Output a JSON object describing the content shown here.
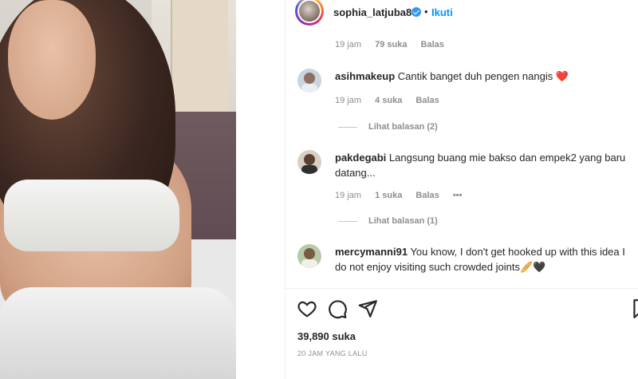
{
  "post": {
    "owner": "sophia_latjuba88",
    "verified": true,
    "separator": "•",
    "follow_label": "Ikuti",
    "likes": "39,890 suka",
    "time_ago": "20 JAM YANG LALU"
  },
  "top_comment_meta": {
    "time": "19 jam",
    "likes": "79 suka",
    "reply": "Balas"
  },
  "comments": [
    {
      "username": "asihmakeup",
      "text": "Cantik banget duh pengen nangis",
      "emoji": "❤️",
      "time": "19 jam",
      "likes": "4 suka",
      "reply": "Balas",
      "view_replies": "Lihat balasan (2)"
    },
    {
      "username": "pakdegabi",
      "text": "Langsung buang mie bakso dan empek2 yang baru datang...",
      "time": "19 jam",
      "likes": "1 suka",
      "reply": "Balas",
      "more": "•••",
      "view_replies": "Lihat balasan (1)"
    },
    {
      "username": "mercymanni91",
      "text": "You know, I don't get hooked up with this idea I do not enjoy visiting such crowded joints",
      "emoji": "🥖🖤"
    }
  ],
  "icons": {
    "like": "heart-icon",
    "comment": "comment-icon",
    "share": "send-icon",
    "save": "bookmark-icon",
    "verified": "verified-badge-icon"
  },
  "colors": {
    "accent": "#0095f6",
    "verified": "#3897f0",
    "heart": "#e0245e"
  }
}
